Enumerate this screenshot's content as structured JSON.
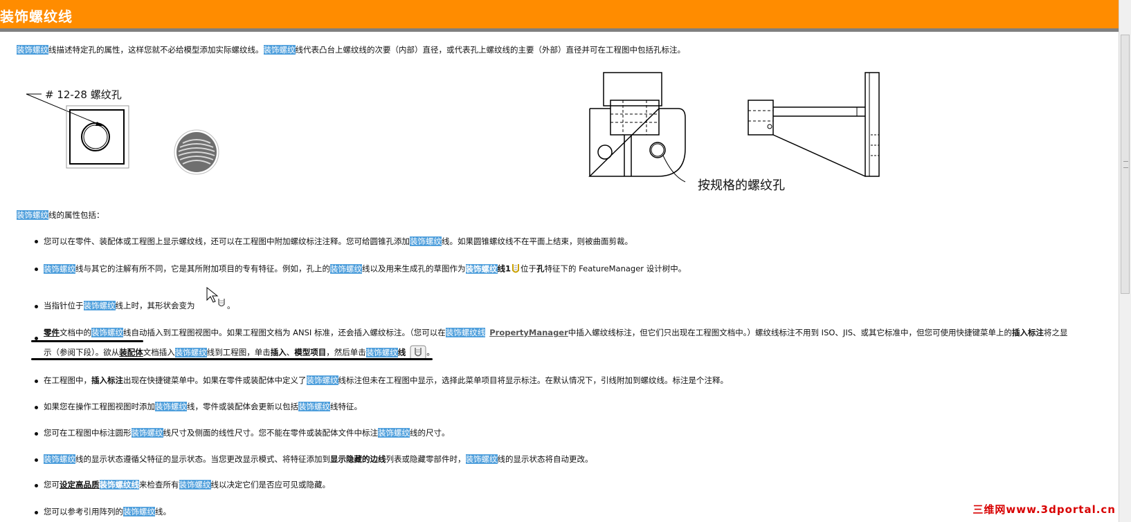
{
  "page": {
    "title": "装饰螺纹线",
    "watermark": "三维网www.3dportal.cn"
  },
  "intro": {
    "hl1": "装饰螺纹",
    "t1": "线描述特定孔的属性，这样您就不必给模型添加实际螺纹线。",
    "hl2": "装饰螺纹",
    "t2": "线代表凸台上螺纹线的次要（内部）直径，或代表孔上螺纹线的主要（外部）直径并可在工程图中包括孔标注。"
  },
  "figures": {
    "left_label": "# 12-28 螺纹孔",
    "right_label": "按规格的螺纹孔"
  },
  "props_heading": {
    "hl": "装饰螺纹",
    "t": "线的属性包括："
  },
  "bullets": {
    "b1": {
      "t1": "您可以在零件、装配体或工程图上显示螺纹线，还可以在工程图中附加螺纹标注注释。您可给圆锥孔添加",
      "hl1": "装饰螺纹",
      "t2": "线。如果圆锥螺纹线不在平面上结束，则被曲面剪裁。"
    },
    "b2": {
      "hl1": "装饰螺纹",
      "t1": "线与其它的注解有所不同，它是其所附加项目的专有特征。例如，孔上的",
      "hl2": "装饰螺纹",
      "t2": "线以及用来生成孔的草图作为",
      "hl3": "装饰螺纹",
      "t3": "线1",
      "t4": "位于",
      "t5": "孔",
      "t6": "特征下的 FeatureManager 设计树中。"
    },
    "b3": {
      "t1": "当指针位于",
      "hl1": "装饰螺纹",
      "t2": "线上时，其形状会变为",
      "t3": "。"
    },
    "b4": {
      "t1": "零件",
      "t2": "文档中的",
      "hl1": "装饰螺纹",
      "t3": "线自动插入到工程图视图中。如果工程图文档为 ANSI 标准，还会插入螺纹标注。（您可以在",
      "hl2": "装饰螺纹线",
      "link": "PropertyManager",
      "t4": "中插入螺纹线标注，但它们只出现在工程图文档中。）螺纹线标注不用到 ISO、JIS、或其它标准中，但您可使用快捷键菜单上的",
      "t5": "插入标注",
      "t6": "将之显",
      "t7": "示（参阅下段）。欲从",
      "t8": "装配体",
      "t9": "文档插入",
      "hl3": "装饰螺纹",
      "t10": "线到工程图，单击",
      "t11": "插入",
      "t12": "、",
      "t13": "模型项目",
      "t14": "，然后单击",
      "hl4": "装饰螺纹",
      "t15": "线",
      "t16": "。"
    },
    "b5": {
      "t1": "在工程图中，",
      "t2": "插入标注",
      "t3": "出现在快捷键菜单中。如果在零件或装配体中定义了",
      "hl1": "装饰螺纹",
      "t4": "线标注但未在工程图中显示，选择此菜单项目将显示标注。在默认情况下，引线附加到螺纹线。标注是个注释。"
    },
    "b6": {
      "t1": "如果您在操作工程图视图时添加",
      "hl1": "装饰螺纹",
      "t2": "线，零件或装配体会更新以包括",
      "hl2": "装饰螺纹",
      "t3": "线特征。"
    },
    "b7": {
      "t1": "您可在工程图中标注圆形",
      "hl1": "装饰螺纹",
      "t2": "线尺寸及侧面的线性尺寸。您不能在零件或装配体文件中标注",
      "hl2": "装饰螺纹",
      "t3": "线的尺寸。"
    },
    "b8": {
      "hl1": "装饰螺纹",
      "t1": "线的显示状态遵循父特征的显示状态。当您更改显示模式、将特征添加到",
      "t2": "显示隐藏的边线",
      "t3": "列表或隐藏零部件时，",
      "hl2": "装饰螺纹",
      "t4": "线的显示状态将自动更改。"
    },
    "b9": {
      "t1": "您可",
      "t2": "设定高品质",
      "hl1": "装饰螺纹线",
      "t3": "来检查所有",
      "hl2": "装饰螺纹",
      "t4": "线以决定它们是否应可见或隐藏。"
    },
    "b10": {
      "t1": "您可以参考引用阵列的",
      "hl1": "装饰螺纹",
      "t2": "线。"
    }
  },
  "colors": {
    "title_bar": "#ff8c00",
    "highlight": "#4f9fdc",
    "watermark": "#d80000"
  }
}
